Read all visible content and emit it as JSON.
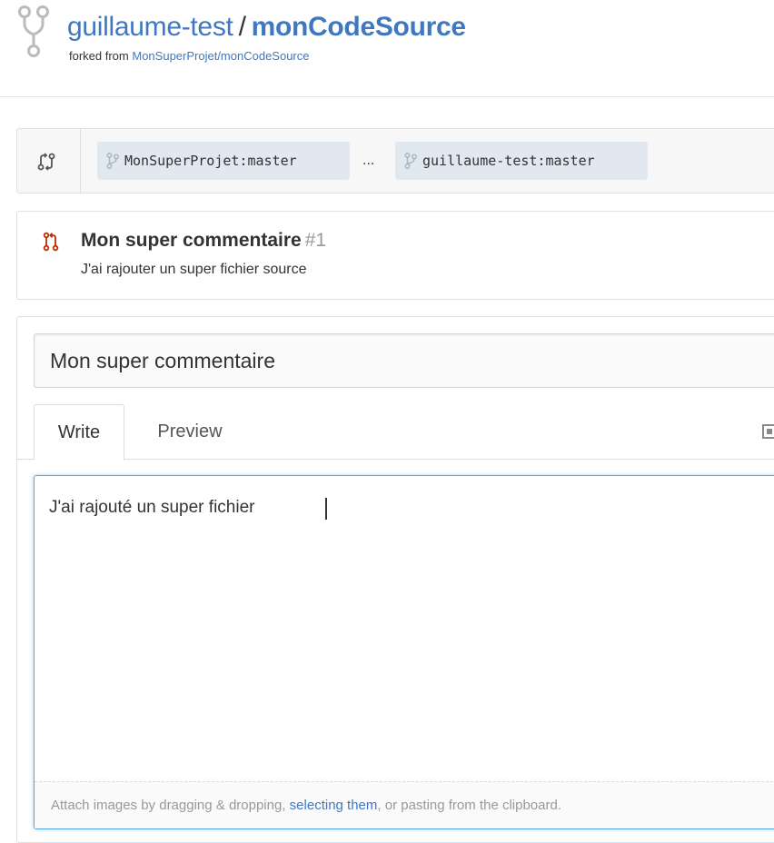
{
  "repo": {
    "owner": "guillaume-test",
    "separator": "/",
    "name": "monCodeSource",
    "forked_prefix": "forked from",
    "forked_source": "MonSuperProjet/monCodeSource"
  },
  "compare": {
    "base_branch": "MonSuperProjet:master",
    "ellipsis": "...",
    "head_branch": "guillaume-test:master"
  },
  "pr_summary": {
    "title": "Mon super commentaire",
    "number": "#1",
    "description": "J'ai rajouter un super fichier source"
  },
  "form": {
    "title_value": "Mon super commentaire",
    "tabs": [
      {
        "label": "Write",
        "active": true
      },
      {
        "label": "Preview",
        "active": false
      }
    ],
    "body_value": "J'ai rajouté un super fichier",
    "drop_hint_prefix": "Attach images by dragging & dropping, ",
    "drop_hint_link": "selecting them",
    "drop_hint_suffix": ", or pasting from the clipboard."
  },
  "colors": {
    "link_blue": "#4078c0",
    "branch_bg": "#e1e8ef",
    "pr_icon_red": "#bd2c00",
    "focus_blue": "#51a7e8"
  },
  "icons": [
    "repo-forked-icon",
    "git-compare-icon",
    "git-branch-icon",
    "git-pull-request-icon",
    "fullscreen-icon"
  ]
}
